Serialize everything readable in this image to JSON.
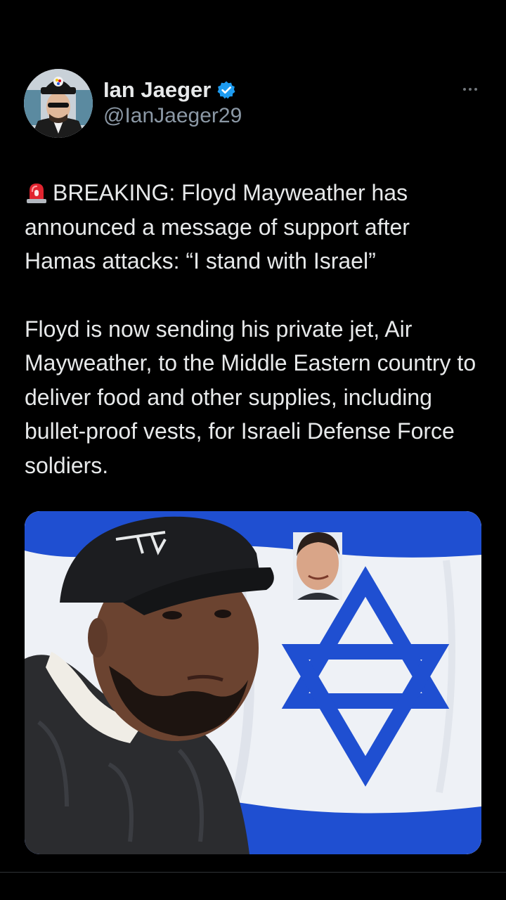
{
  "author": {
    "name": "Ian Jaeger",
    "handle": "@IanJaeger29",
    "verified": true,
    "verified_color": "#1d9bf0"
  },
  "tweet": {
    "emoji_icon": "police-siren-icon",
    "paragraph_1": "BREAKING: Floyd Mayweather has announced a message of support after Hamas attacks: “I stand with Israel”",
    "paragraph_2": "Floyd is now sending his private jet, Air Mayweather, to the Middle Eastern country to deliver food and other supplies, including bullet-proof vests, for Israeli Defense Force soldiers."
  },
  "colors": {
    "background": "#000000",
    "text": "#e7e9ea",
    "secondary_text": "#8b98a5",
    "flag_blue": "#1f4fd1",
    "flag_white": "#f2f4f8"
  }
}
